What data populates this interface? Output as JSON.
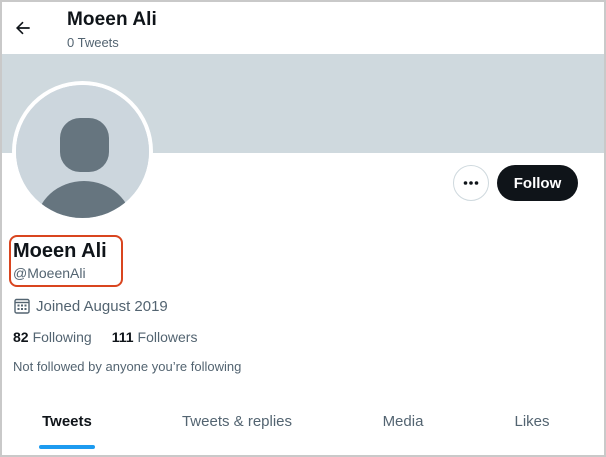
{
  "header": {
    "name": "Moeen Ali",
    "tweet_count": "0 Tweets"
  },
  "icons": {
    "back": "arrow-left-icon",
    "more": "more-horizontal-icon",
    "calendar": "calendar-icon",
    "avatar": "default-avatar-silhouette"
  },
  "profile": {
    "name": "Moeen Ali",
    "handle": "@MoeenAli",
    "joined": "Joined August 2019",
    "following_count": "82",
    "following_label": "Following",
    "followers_count": "111",
    "followers_label": "Followers",
    "not_followed": "Not followed by anyone you’re following"
  },
  "actions": {
    "follow_label": "Follow"
  },
  "tabs": [
    {
      "label": "Tweets",
      "active": true
    },
    {
      "label": "Tweets & replies",
      "active": false
    },
    {
      "label": "Media",
      "active": false
    },
    {
      "label": "Likes",
      "active": false
    }
  ],
  "colors": {
    "banner": "#cfd9de",
    "accent": "#1d9bf0",
    "follow_button": "#0f1419",
    "highlight": "#d9451f",
    "secondary_text": "#536471"
  }
}
